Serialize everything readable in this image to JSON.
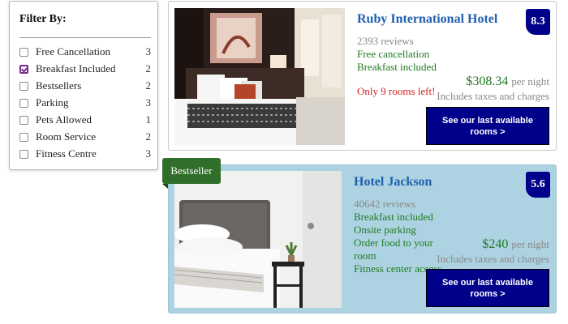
{
  "filter": {
    "title": "Filter By:",
    "items": [
      {
        "label": "Free Cancellation",
        "count": "3",
        "checked": false
      },
      {
        "label": "Breakfast Included",
        "count": "2",
        "checked": true
      },
      {
        "label": "Bestsellers",
        "count": "2",
        "checked": false
      },
      {
        "label": "Parking",
        "count": "3",
        "checked": false
      },
      {
        "label": "Pets Allowed",
        "count": "1",
        "checked": false
      },
      {
        "label": "Room Service",
        "count": "2",
        "checked": false
      },
      {
        "label": "Fitness Centre",
        "count": "3",
        "checked": false
      }
    ]
  },
  "hotels": [
    {
      "name": "Ruby International Hotel",
      "score": "8.3",
      "reviews": "2393 reviews",
      "features": [
        "Free cancellation",
        "Breakfast included"
      ],
      "warning": "Only 9 rooms left!",
      "price": "$308.34",
      "per_night": "per night",
      "taxes": "Includes taxes and charges",
      "cta": "See our last available rooms >"
    },
    {
      "badge": "Bestseller",
      "name": "Hotel Jackson",
      "score": "5.6",
      "reviews": "40642 reviews",
      "features": [
        "Breakfast included",
        "Onsite parking",
        "Order food to your room",
        "Fitness center access"
      ],
      "price": "$240",
      "per_night": "per night",
      "taxes": "Includes taxes and charges",
      "cta": "See our last available rooms >"
    }
  ],
  "colors": {
    "accent": "#00008b",
    "hotel_name": "#1f5fae",
    "feature_green": "#1f7a1f",
    "warning_red": "#d42020",
    "highlight_bg": "#add3e3",
    "badge_green": "#2f6f2a"
  }
}
